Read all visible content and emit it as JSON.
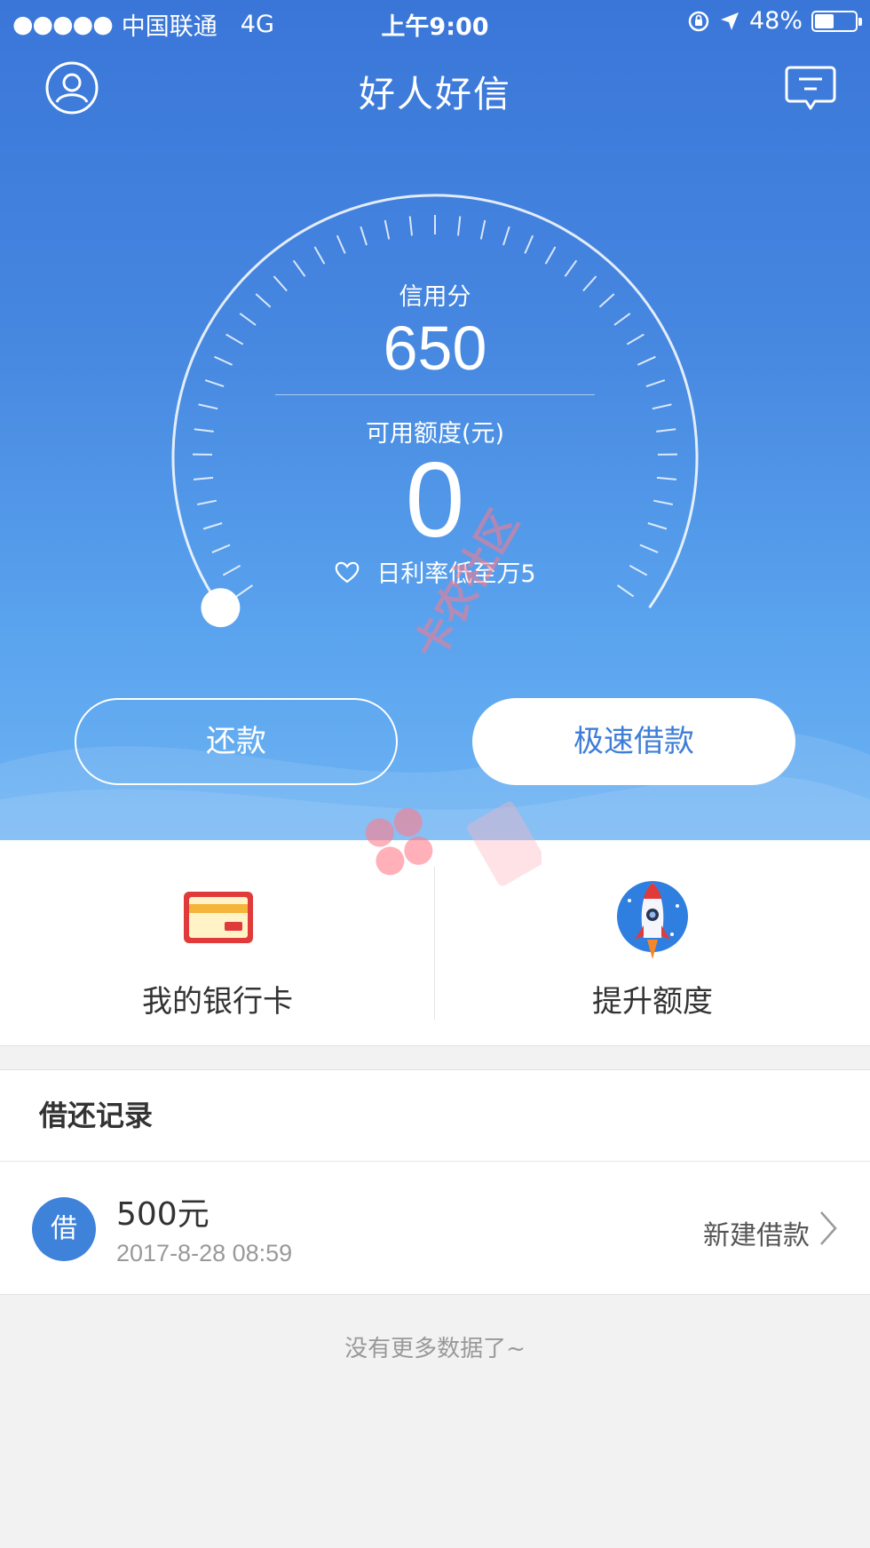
{
  "status_bar": {
    "signal": "●●●●●",
    "carrier": "中国联通",
    "network": "4G",
    "time": "上午9:00",
    "battery_percent": "48%",
    "battery_level": 0.48
  },
  "header": {
    "title": "好人好信",
    "user_icon": "user-icon",
    "message_icon": "message-icon"
  },
  "gauge": {
    "score_label": "信用分",
    "score": "650",
    "limit_label": "可用额度(元)",
    "limit_value": "0",
    "rate_text": "日利率低至万5",
    "rate_icon": "heart-outline-icon"
  },
  "actions": {
    "repay_label": "还款",
    "loan_label": "极速借款"
  },
  "shortcuts": [
    {
      "label": "我的银行卡",
      "icon": "bank-card-icon"
    },
    {
      "label": "提升额度",
      "icon": "rocket-icon"
    }
  ],
  "records": {
    "title": "借还记录",
    "items": [
      {
        "badge": "借",
        "amount": "500元",
        "date": "2017-8-28 08:59",
        "action": "新建借款"
      }
    ]
  },
  "footer": {
    "no_more": "没有更多数据了~"
  },
  "watermark": {
    "text": "卡农社区"
  },
  "colors": {
    "primary_blue": "#3f7ed8",
    "hero_top": "#3a76d8",
    "hero_bottom": "#6db3f3",
    "card_red": "#e03a3a",
    "card_yellow": "#f5b43a"
  }
}
